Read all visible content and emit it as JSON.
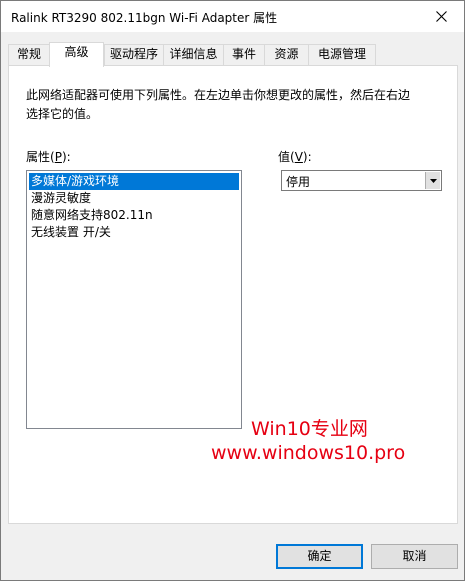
{
  "window": {
    "title": "Ralink RT3290 802.11bgn Wi-Fi Adapter 属性"
  },
  "tabs": [
    {
      "label": "常规"
    },
    {
      "label": "高级",
      "active": true
    },
    {
      "label": "驱动程序"
    },
    {
      "label": "详细信息"
    },
    {
      "label": "事件"
    },
    {
      "label": "资源"
    },
    {
      "label": "电源管理"
    }
  ],
  "panel": {
    "description": "此网络适配器可使用下列属性。在左边单击你想更改的属性，然后在右边选择它的值。",
    "property_label": "属性(",
    "property_label_key": "P",
    "property_label_end": "):",
    "value_label": "值(",
    "value_label_key": "V",
    "value_label_end": "):",
    "properties": [
      {
        "label": "多媒体/游戏环境",
        "selected": true
      },
      {
        "label": "漫游灵敏度"
      },
      {
        "label": "随意网络支持802.11n"
      },
      {
        "label": "无线装置 开/关"
      }
    ],
    "value_selected": "停用"
  },
  "watermark": {
    "line1": "Win10专业网",
    "line2": "www.windows10.pro",
    "color": "#e60012"
  },
  "buttons": {
    "ok": "确定",
    "cancel": "取消"
  },
  "colors": {
    "selection": "#0078d7"
  }
}
